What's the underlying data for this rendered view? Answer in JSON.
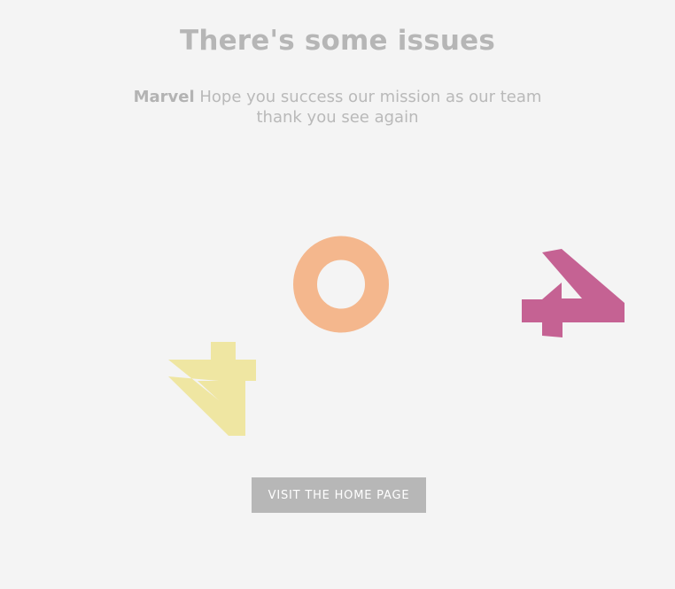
{
  "header": {
    "title": "There's some issues"
  },
  "message": {
    "brand": "Marvel",
    "text": " Hope you success our mission as our team thank you see again"
  },
  "error_digits": {
    "left": "4",
    "middle": "0",
    "right": "4",
    "colors": {
      "left": "#efe6a2",
      "middle": "#f4b78d",
      "right": "#c56293"
    }
  },
  "actions": {
    "home_button_label": "VISIT THE HOME PAGE"
  }
}
